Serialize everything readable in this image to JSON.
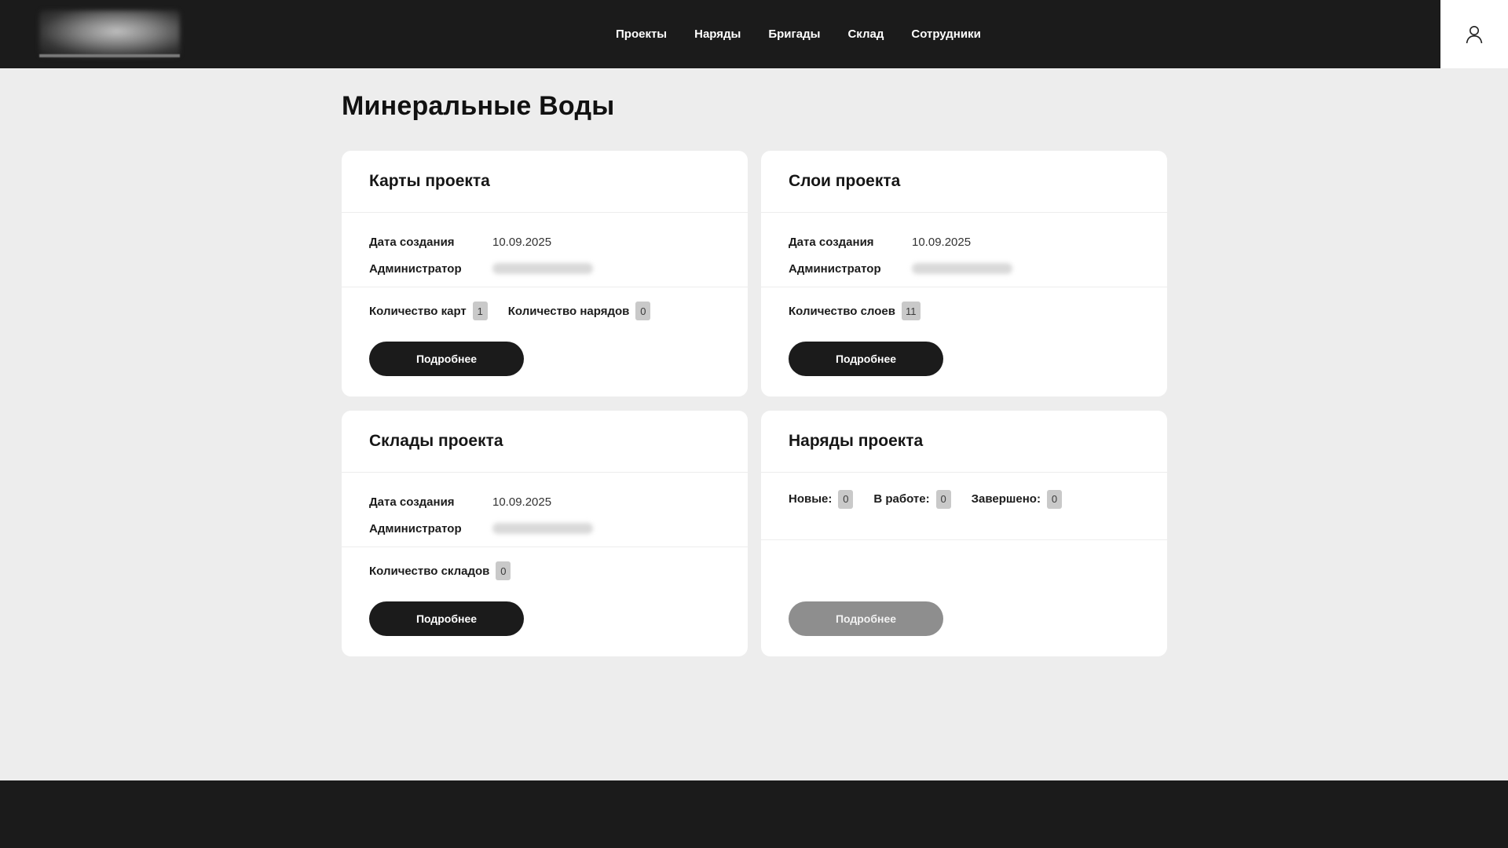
{
  "nav": {
    "items": [
      "Проекты",
      "Наряды",
      "Бригады",
      "Склад",
      "Сотрудники"
    ],
    "user_icon": "user-icon"
  },
  "page": {
    "title": "Минеральные Воды"
  },
  "labels": {
    "created": "Дата создания",
    "admin": "Администратор",
    "details": "Подробнее"
  },
  "cards": {
    "maps": {
      "title": "Карты проекта",
      "created_value": "10.09.2025",
      "count1_label": "Количество карт",
      "count1_value": "1",
      "count2_label": "Количество нарядов",
      "count2_value": "0"
    },
    "layers": {
      "title": "Слои проекта",
      "created_value": "10.09.2025",
      "count1_label": "Количество слоев",
      "count1_value": "11"
    },
    "warehouses": {
      "title": "Склады проекта",
      "created_value": "10.09.2025",
      "count1_label": "Количество складов",
      "count1_value": "0"
    },
    "orders": {
      "title": "Наряды проекта",
      "new_label": "Новые:",
      "new_value": "0",
      "inwork_label": "В работе:",
      "inwork_value": "0",
      "done_label": "Завершено:",
      "done_value": "0"
    }
  },
  "colors": {
    "header_bg": "#1b1b1b",
    "page_bg": "#ededed",
    "card_bg": "#ffffff",
    "button_bg": "#1b1b1b",
    "button_disabled_bg": "#8e8e8e",
    "badge_bg": "#c9c9c9"
  }
}
